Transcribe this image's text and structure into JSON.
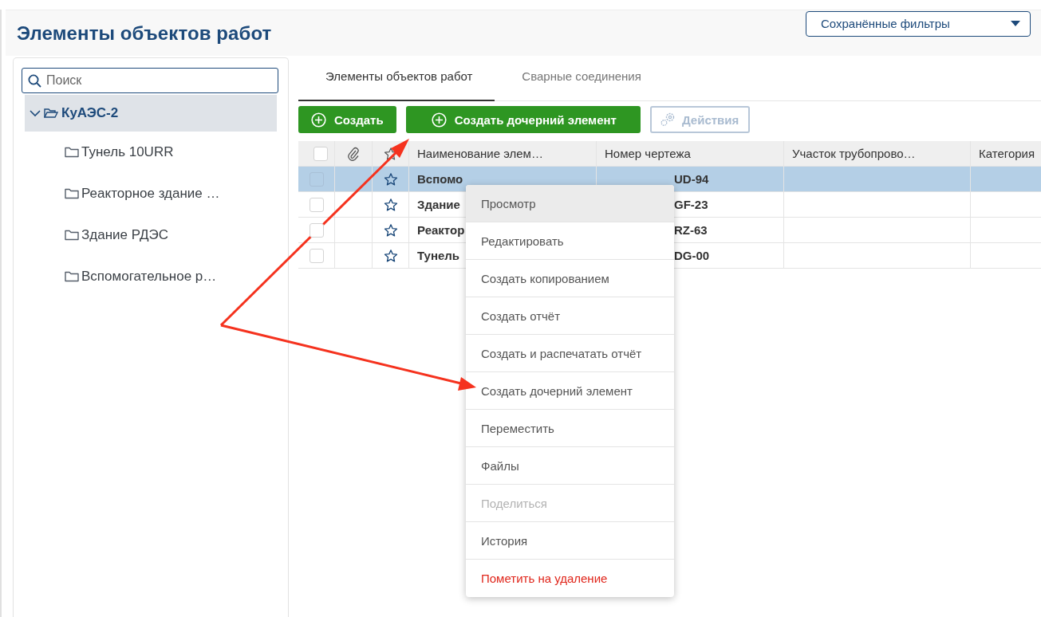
{
  "header": {
    "title": "Элементы объектов работ",
    "saved_filters": "Сохранённые фильтры"
  },
  "search": {
    "placeholder": "Поиск"
  },
  "tree": [
    {
      "label": "КуАЭС-2",
      "expanded": true,
      "selected": true,
      "children": [
        {
          "label": "Тунель 10URR",
          "selected": false
        },
        {
          "label": "Реакторное здание …",
          "selected": false
        },
        {
          "label": "Здание РДЭС",
          "selected": false
        },
        {
          "label": "Вспомогательное р…",
          "selected": false
        }
      ]
    }
  ],
  "tabs": [
    {
      "label": "Элементы объектов работ",
      "selected": true
    },
    {
      "label": "Сварные соединения",
      "selected": false
    }
  ],
  "toolbar": [
    {
      "label": "Создать",
      "kind": "create",
      "disabled": false
    },
    {
      "label": "Создать дочерний элемент",
      "kind": "create",
      "disabled": false
    },
    {
      "label": "Действия",
      "kind": "actions",
      "disabled": true
    }
  ],
  "table": {
    "select_all": {
      "checked": false
    },
    "columns": [
      "Наименование элем…",
      "Номер чертежа",
      "Участок трубопрово…",
      "Категория"
    ],
    "rows": [
      {
        "selected": true,
        "checked": false,
        "starred": false,
        "name": "Вспомо",
        "number": "UD-94"
      },
      {
        "selected": false,
        "checked": false,
        "starred": false,
        "name": "Здание",
        "number": "GF-23"
      },
      {
        "selected": false,
        "checked": false,
        "starred": false,
        "name": "Реактор",
        "number": "RZ-63"
      },
      {
        "selected": false,
        "checked": false,
        "starred": false,
        "name": "Тунель",
        "number": "DG-00"
      }
    ]
  },
  "context_menu": [
    {
      "label": "Просмотр",
      "selected": true,
      "disabled": false,
      "kind": "normal"
    },
    {
      "label": "Редактировать",
      "selected": false,
      "disabled": false,
      "kind": "normal"
    },
    {
      "label": "Создать копированием",
      "selected": false,
      "disabled": false,
      "kind": "normal"
    },
    {
      "label": "Создать отчёт",
      "selected": false,
      "disabled": false,
      "kind": "normal"
    },
    {
      "label": "Создать и распечатать отчёт",
      "selected": false,
      "disabled": false,
      "kind": "normal"
    },
    {
      "label": "Создать дочерний элемент",
      "selected": false,
      "disabled": false,
      "kind": "normal"
    },
    {
      "label": "Переместить",
      "selected": false,
      "disabled": false,
      "kind": "normal"
    },
    {
      "label": "Файлы",
      "selected": false,
      "disabled": false,
      "kind": "normal"
    },
    {
      "label": "Поделиться",
      "selected": false,
      "disabled": true,
      "kind": "normal"
    },
    {
      "label": "История",
      "selected": false,
      "disabled": false,
      "kind": "normal"
    },
    {
      "label": "Пометить на удаление",
      "selected": false,
      "disabled": false,
      "kind": "danger"
    }
  ]
}
